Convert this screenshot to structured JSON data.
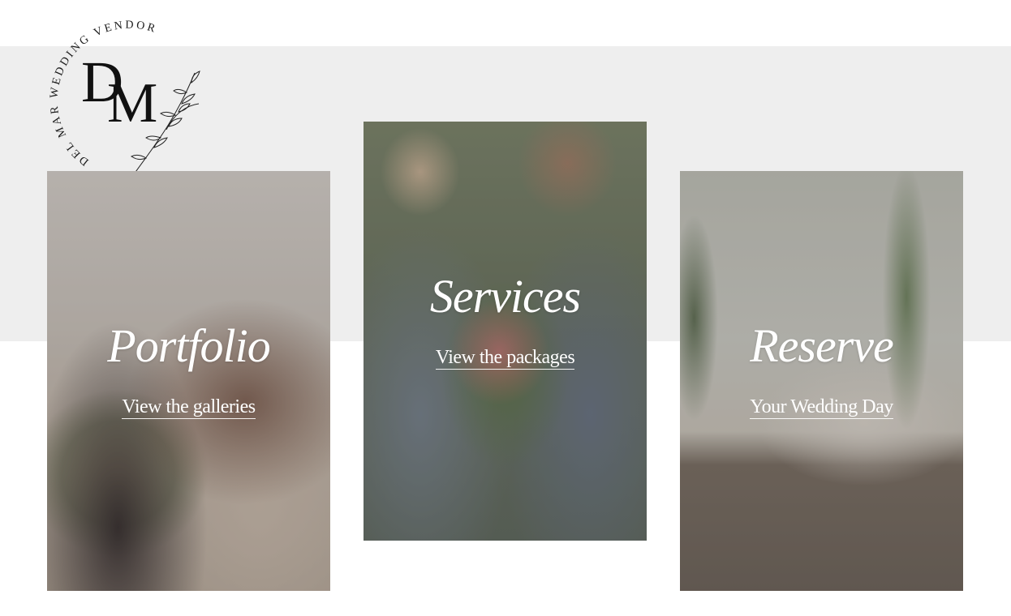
{
  "logo": {
    "arc_text": "DEL MAR WEDDING VENDOR",
    "monogram_d": "D",
    "monogram_m": "M"
  },
  "cards": [
    {
      "title": "Portfolio",
      "link": "View the galleries"
    },
    {
      "title": "Services",
      "link": "View the packages"
    },
    {
      "title": "Reserve",
      "link": "Your Wedding Day"
    }
  ],
  "colors": {
    "band": "#eeeeee",
    "text_on_photo": "#ffffff",
    "logo": "#111111"
  },
  "icons": [
    "leaf-branch-icon"
  ]
}
